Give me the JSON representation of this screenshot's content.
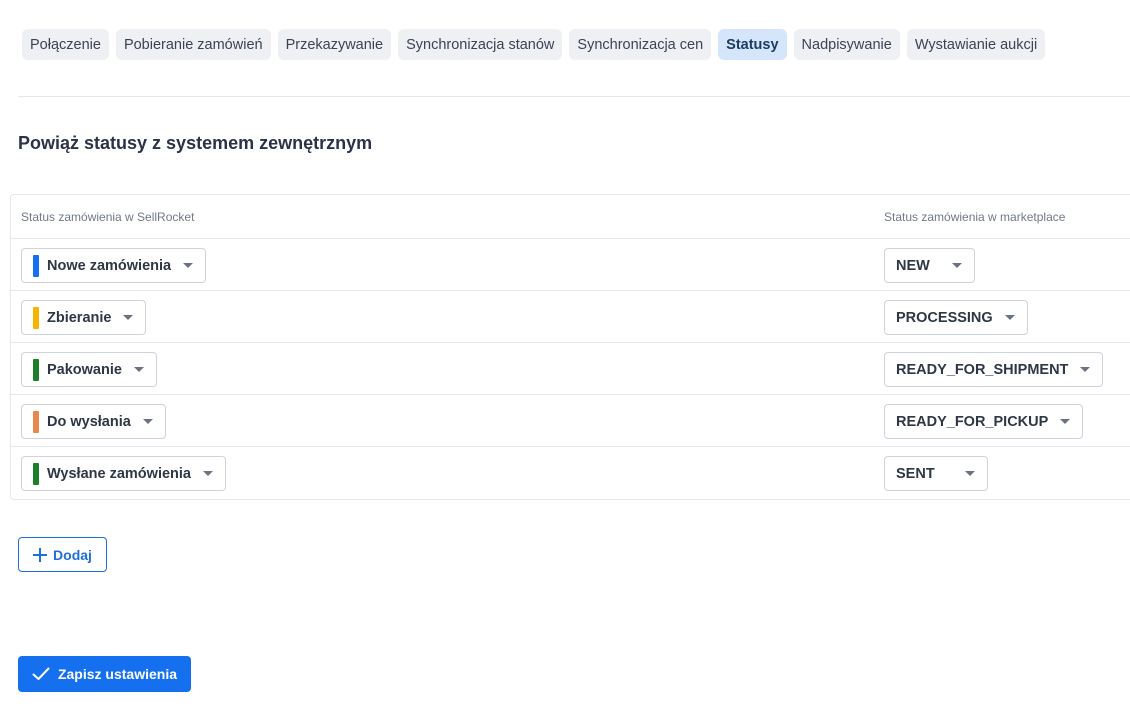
{
  "tabs": [
    {
      "label": "Połączenie",
      "active": false
    },
    {
      "label": "Pobieranie zamówień",
      "active": false
    },
    {
      "label": "Przekazywanie",
      "active": false
    },
    {
      "label": "Synchronizacja stanów",
      "active": false
    },
    {
      "label": "Synchronizacja cen",
      "active": false
    },
    {
      "label": "Statusy",
      "active": true
    },
    {
      "label": "Nadpisywanie",
      "active": false
    },
    {
      "label": "Wystawianie aukcji",
      "active": false
    }
  ],
  "heading": "Powiąż statusy z systemem zewnętrznym",
  "table": {
    "col_left": "Status zamówienia w SellRocket",
    "col_right": "Status zamówienia w marketplace",
    "rows": [
      {
        "status": "Nowe zamówienia",
        "color": "#1570ef",
        "marketplace": "NEW"
      },
      {
        "status": "Zbieranie",
        "color": "#f4b400",
        "marketplace": "PROCESSING"
      },
      {
        "status": "Pakowanie",
        "color": "#1b7f2a",
        "marketplace": "READY_FOR_SHIPMENT"
      },
      {
        "status": "Do wysłania",
        "color": "#e8884e",
        "marketplace": "READY_FOR_PICKUP"
      },
      {
        "status": "Wysłane zamówienia",
        "color": "#1b7f2a",
        "marketplace": "SENT"
      }
    ]
  },
  "add_button": "Dodaj",
  "save_button": "Zapisz ustawienia",
  "icons": {
    "add": "plus-icon",
    "save": "check-icon",
    "dropdown": "caret-down-icon"
  }
}
